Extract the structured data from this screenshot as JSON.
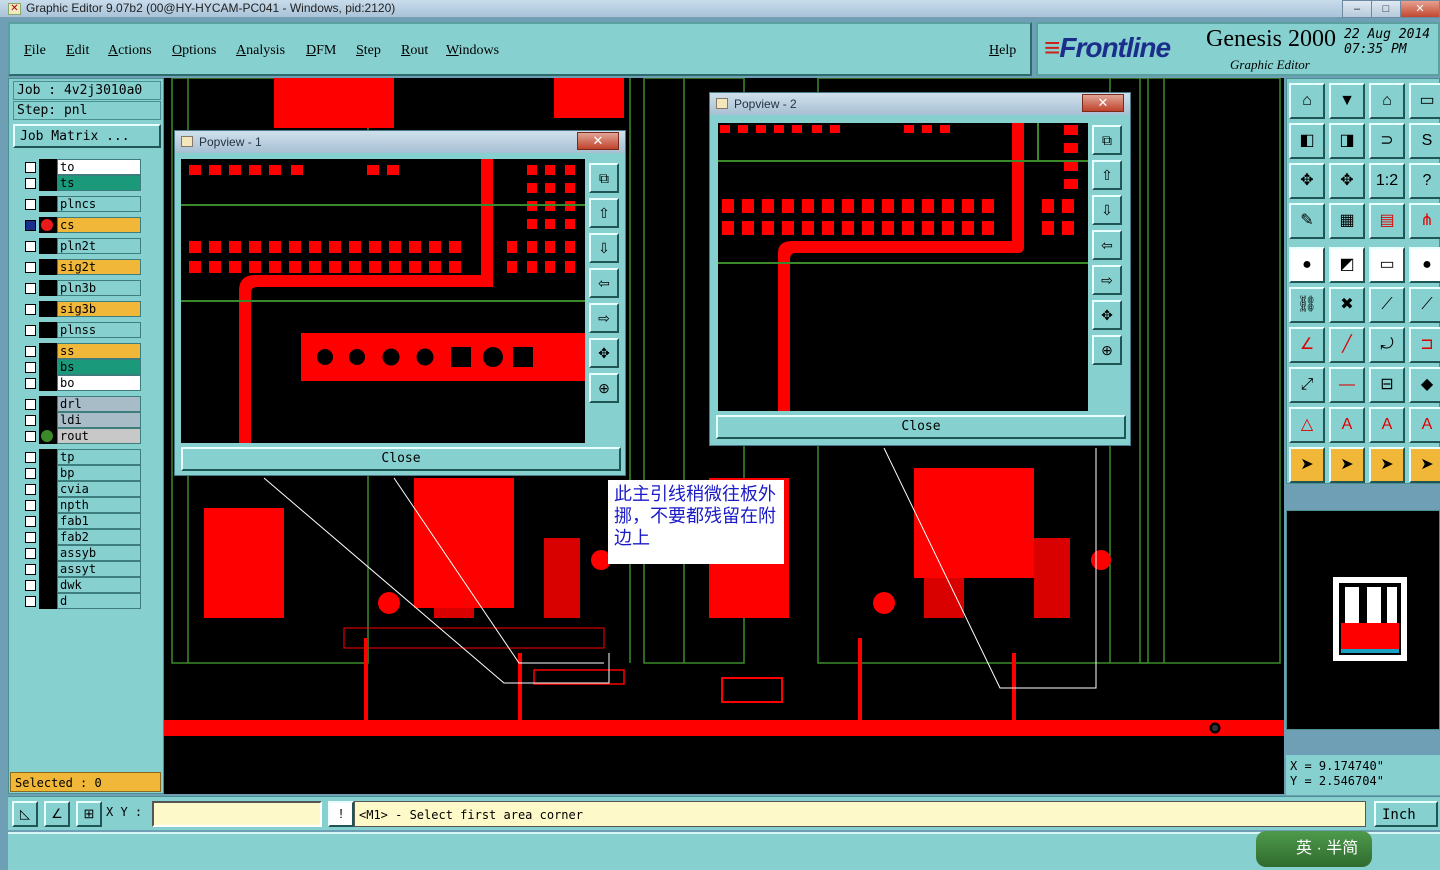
{
  "window": {
    "title": "Graphic Editor 9.07b2 (00@HY-HYCAM-PC041 - Windows, pid:2120)"
  },
  "menu": [
    "File",
    "Edit",
    "Actions",
    "Options",
    "Analysis",
    "DFM",
    "Step",
    "Rout",
    "Windows"
  ],
  "help_label": "Help",
  "brand": {
    "logo": "Frontline",
    "product": "Genesis 2000",
    "subtitle": "Graphic Editor",
    "date": "22 Aug 2014",
    "time": "07:35 PM"
  },
  "job": {
    "job_label": "Job : 4v2j3010a0",
    "step_label": "Step: pnl",
    "matrix_button": "Job Matrix ..."
  },
  "layers": [
    {
      "name": "to",
      "color": "#ffffff"
    },
    {
      "name": "ts",
      "color": "#1a9a7a"
    },
    {
      "name": "plncs",
      "color": "#86d0d0"
    },
    {
      "name": "cs",
      "color": "#f1b738",
      "active": true
    },
    {
      "name": "pln2t",
      "color": "#86d0d0"
    },
    {
      "name": "sig2t",
      "color": "#f1b738"
    },
    {
      "name": "pln3b",
      "color": "#86d0d0"
    },
    {
      "name": "sig3b",
      "color": "#f1b738"
    },
    {
      "name": "plnss",
      "color": "#86d0d0"
    },
    {
      "name": "ss",
      "color": "#f1b738"
    },
    {
      "name": "bs",
      "color": "#1a9a7a"
    },
    {
      "name": "bo",
      "color": "#ffffff"
    },
    {
      "name": "drl",
      "color": "#a8bcc8"
    },
    {
      "name": "ldi",
      "color": "#a8bcc8"
    },
    {
      "name": "rout",
      "color": "#c8c8c8"
    },
    {
      "name": "tp",
      "color": "#86d0d0"
    },
    {
      "name": "bp",
      "color": "#86d0d0"
    },
    {
      "name": "cvia",
      "color": "#86d0d0"
    },
    {
      "name": "npth",
      "color": "#86d0d0"
    },
    {
      "name": "fab1",
      "color": "#86d0d0"
    },
    {
      "name": "fab2",
      "color": "#86d0d0"
    },
    {
      "name": "assyb",
      "color": "#86d0d0"
    },
    {
      "name": "assyt",
      "color": "#86d0d0"
    },
    {
      "name": "dwk",
      "color": "#86d0d0"
    },
    {
      "name": "d",
      "color": "#86d0d0"
    }
  ],
  "selected_label": "Selected : 0",
  "popview1": {
    "title": "Popview - 1",
    "close_label": "Close"
  },
  "popview2": {
    "title": "Popview - 2",
    "close_label": "Close"
  },
  "close_x": "✕",
  "annotation": "此主引线稍微往板外挪，不要都残留在附边上",
  "coords": {
    "x": "X = 9.174740\"",
    "y": "Y = 2.546704\""
  },
  "status": {
    "xy_label": "X Y :",
    "xy_value": "",
    "message": "<M1> - Select first area corner",
    "unit": "Inch"
  },
  "ime": "英 · 半简",
  "colors": {
    "copper": "#ff0000",
    "outline": "#3a8a2a",
    "panel": "#86d0d0",
    "highlight": "#f1b738"
  }
}
